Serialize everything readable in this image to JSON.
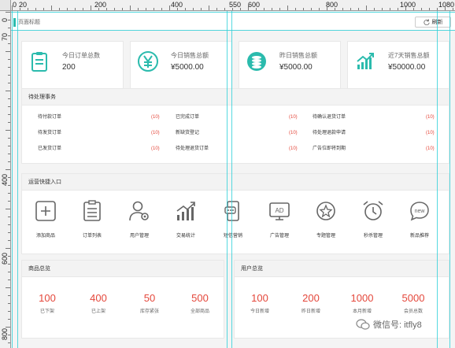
{
  "ruler": {
    "top_labels": [
      "0",
      "20",
      "200",
      "400",
      "550",
      "600",
      "800",
      "1000",
      "1080"
    ],
    "left_labels": [
      "0",
      "70",
      "400",
      "600",
      "800"
    ]
  },
  "header": {
    "title": "页面标题",
    "refresh_label": "刷新"
  },
  "stats": [
    {
      "label": "今日订单总数",
      "value": "200",
      "icon": "clipboard-icon"
    },
    {
      "label": "今日销售总额",
      "value": "¥5000.00",
      "icon": "yen-icon"
    },
    {
      "label": "昨日销售总额",
      "value": "¥5000.00",
      "icon": "coins-icon"
    },
    {
      "label": "近7天销售总额",
      "value": "¥50000.00",
      "icon": "trend-icon"
    }
  ],
  "todo": {
    "title": "待处理事务",
    "rows": [
      [
        {
          "label": "待付款订单",
          "count": "(10)"
        },
        {
          "label": "已完成订单",
          "count": "(10)"
        },
        {
          "label": "待确认退货订单",
          "count": "(10)"
        }
      ],
      [
        {
          "label": "待发货订单",
          "count": "(10)"
        },
        {
          "label": "新缺货登记",
          "count": "(10)"
        },
        {
          "label": "待处理退款申请",
          "count": "(10)"
        }
      ],
      [
        {
          "label": "已发货订单",
          "count": "(10)"
        },
        {
          "label": "待处理退货订单",
          "count": "(10)"
        },
        {
          "label": "广告位即将到期",
          "count": "(10)"
        }
      ]
    ]
  },
  "shortcuts": {
    "title": "运营快捷入口",
    "items": [
      {
        "label": "添加商品",
        "icon": "add-box-icon"
      },
      {
        "label": "订单列表",
        "icon": "order-list-icon"
      },
      {
        "label": "用户管理",
        "icon": "user-gear-icon"
      },
      {
        "label": "交易统计",
        "icon": "bar-trend-icon"
      },
      {
        "label": "短信营销",
        "icon": "phone-message-icon"
      },
      {
        "label": "广告管理",
        "icon": "ad-screen-icon"
      },
      {
        "label": "专题管理",
        "icon": "star-circle-icon"
      },
      {
        "label": "秒杀管理",
        "icon": "alarm-clock-icon"
      },
      {
        "label": "新品推荐",
        "icon": "new-bubble-icon"
      }
    ]
  },
  "products": {
    "title": "商品总览",
    "items": [
      {
        "value": "100",
        "label": "已下架"
      },
      {
        "value": "400",
        "label": "已上架"
      },
      {
        "value": "50",
        "label": "库存紧张"
      },
      {
        "value": "500",
        "label": "全部商品"
      }
    ]
  },
  "users": {
    "title": "用户总览",
    "items": [
      {
        "value": "100",
        "label": "今日新增"
      },
      {
        "value": "200",
        "label": "昨日新增"
      },
      {
        "value": "1000",
        "label": "本月新增"
      },
      {
        "value": "5000",
        "label": "会员总数"
      }
    ]
  },
  "watermark": {
    "text": "微信号: itfly8"
  },
  "colors": {
    "accent": "#2bbbad",
    "red": "#e4473b",
    "guide": "#2cd0d8"
  }
}
